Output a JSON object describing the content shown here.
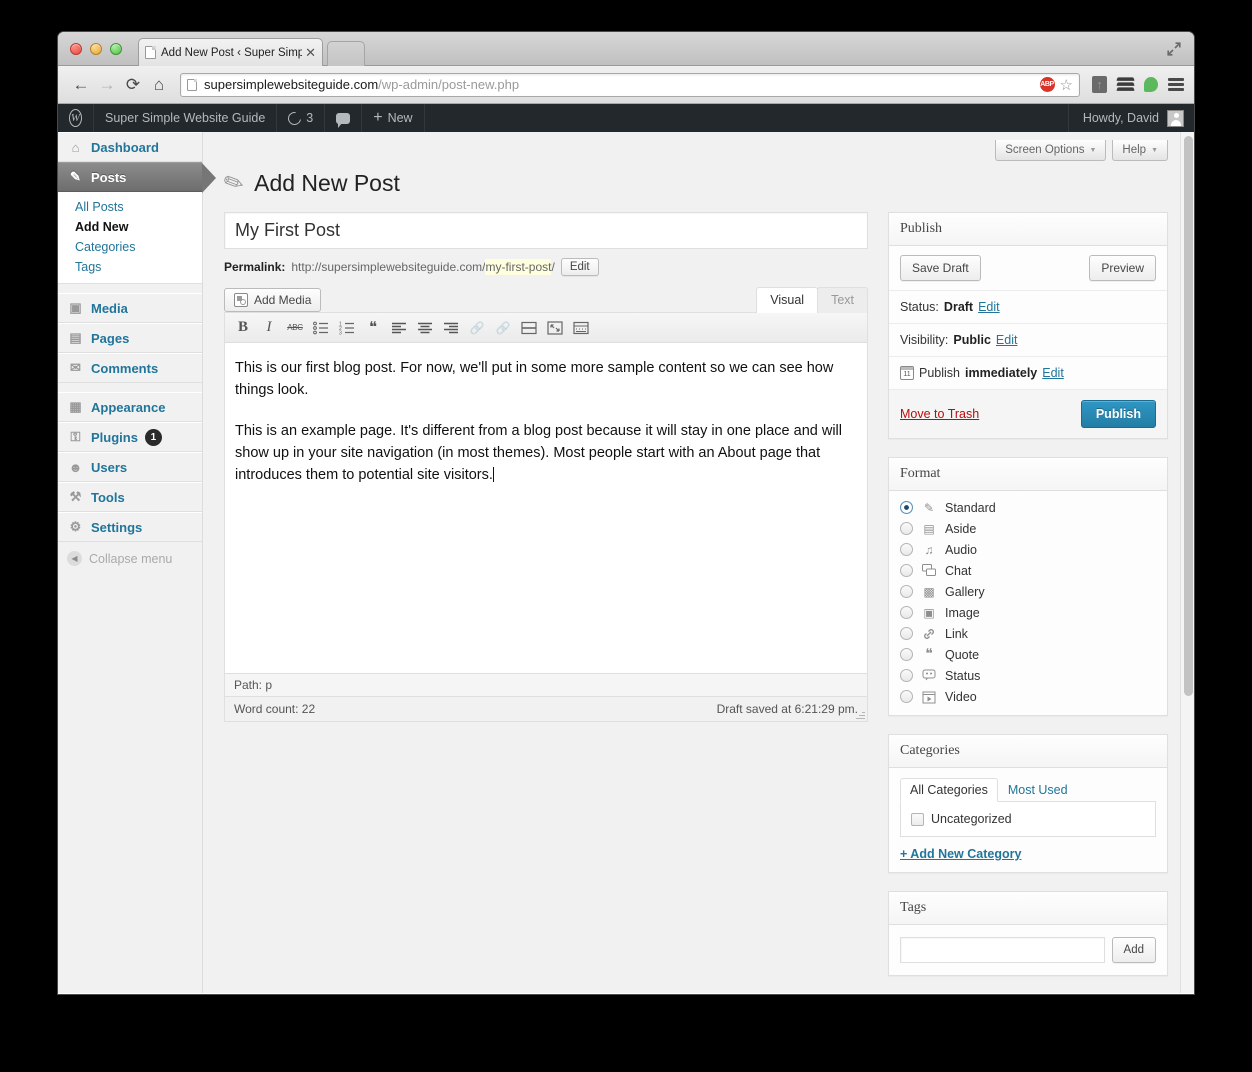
{
  "browser": {
    "tab_title": "Add New Post ‹ Super Simp",
    "tab_close": "✕",
    "url_domain": "supersimplewebsiteguide.com",
    "url_path": "/wp-admin/post-new.php",
    "back_icon": "←",
    "forward_icon": "→",
    "reload_icon": "⟳",
    "home_icon": "⌂",
    "abp_label": "ABP",
    "star_icon": "☆",
    "expand_icon": "⤢",
    "extensions": [
      "evernote-icon",
      "layers-icon",
      "bubble-icon",
      "menu-icon"
    ]
  },
  "adminbar": {
    "logo": "W",
    "site_name": "Super Simple Website Guide",
    "updates_count": "3",
    "comments_icon": "comment-icon",
    "new_label": "New",
    "plus": "+",
    "howdy": "Howdy, David"
  },
  "sidebar": {
    "items": [
      {
        "label": "Dashboard",
        "icon": "⌂",
        "current": false
      },
      {
        "label": "Posts",
        "icon": "✎",
        "current": true
      },
      {
        "label": "Media",
        "icon": "▣",
        "current": false
      },
      {
        "label": "Pages",
        "icon": "▤",
        "current": false
      },
      {
        "label": "Comments",
        "icon": "✉",
        "current": false
      },
      {
        "label": "Appearance",
        "icon": "▦",
        "current": false
      },
      {
        "label": "Plugins",
        "icon": "⚿",
        "current": false,
        "badge": "1"
      },
      {
        "label": "Users",
        "icon": "☻",
        "current": false
      },
      {
        "label": "Tools",
        "icon": "⚒",
        "current": false
      },
      {
        "label": "Settings",
        "icon": "⚙",
        "current": false
      }
    ],
    "submenu": [
      {
        "label": "All Posts",
        "current": false
      },
      {
        "label": "Add New",
        "current": true
      },
      {
        "label": "Categories",
        "current": false
      },
      {
        "label": "Tags",
        "current": false
      }
    ],
    "collapse_label": "Collapse menu",
    "collapse_icon": "◀"
  },
  "screen_meta": {
    "screen_options": "Screen Options",
    "help": "Help",
    "caret": "▼"
  },
  "page": {
    "title": "Add New Post",
    "pin_icon": "pin-icon"
  },
  "editor": {
    "post_title": "My First Post",
    "post_title_placeholder": "Enter title here",
    "permalink_label": "Permalink:",
    "permalink_base": "http://supersimplewebsiteguide.com/",
    "permalink_slug": "my-first-post",
    "permalink_trailing": "/",
    "permalink_edit": "Edit",
    "add_media": "Add Media",
    "tab_visual": "Visual",
    "tab_text": "Text",
    "toolbar": [
      {
        "name": "bold",
        "glyph": "B",
        "disabled": false
      },
      {
        "name": "italic",
        "glyph": "I",
        "disabled": false
      },
      {
        "name": "strikethrough",
        "glyph": "ABC",
        "disabled": false
      },
      {
        "name": "unordered-list",
        "glyph": "☰",
        "disabled": false
      },
      {
        "name": "ordered-list",
        "glyph": "☰",
        "disabled": false
      },
      {
        "name": "blockquote",
        "glyph": "❝",
        "disabled": false
      },
      {
        "name": "align-left",
        "glyph": "≡",
        "disabled": false
      },
      {
        "name": "align-center",
        "glyph": "≡",
        "disabled": false
      },
      {
        "name": "align-right",
        "glyph": "≡",
        "disabled": false
      },
      {
        "name": "insert-link",
        "glyph": "🔗",
        "disabled": true
      },
      {
        "name": "unlink",
        "glyph": "🔗",
        "disabled": true
      },
      {
        "name": "insert-more-tag",
        "glyph": "▤",
        "disabled": false
      },
      {
        "name": "fullscreen",
        "glyph": "⤢",
        "disabled": false
      },
      {
        "name": "kitchen-sink",
        "glyph": "▥",
        "disabled": false
      }
    ],
    "paragraphs": [
      "This is our first blog post. For now, we'll put in some more sample content so we can see how things look.",
      "This is an example page. It's different from a blog post because it will stay in one place and will show up in your site navigation (in most themes). Most people start with an About page that introduces them to potential site visitors."
    ],
    "path_label": "Path: p",
    "word_count": "Word count: 22",
    "draft_saved": "Draft saved at 6:21:29 pm."
  },
  "publish": {
    "heading": "Publish",
    "save_draft": "Save Draft",
    "preview": "Preview",
    "status_label": "Status:",
    "status_value": "Draft",
    "status_edit": "Edit",
    "visibility_label": "Visibility:",
    "visibility_value": "Public",
    "visibility_edit": "Edit",
    "publish_label": "Publish",
    "publish_value": "immediately",
    "publish_edit": "Edit",
    "trash": "Move to Trash",
    "publish_button": "Publish"
  },
  "format": {
    "heading": "Format",
    "options": [
      {
        "label": "Standard",
        "icon": "✎",
        "selected": true
      },
      {
        "label": "Aside",
        "icon": "▤",
        "selected": false
      },
      {
        "label": "Audio",
        "icon": "♫",
        "selected": false
      },
      {
        "label": "Chat",
        "icon": "💬",
        "selected": false
      },
      {
        "label": "Gallery",
        "icon": "▩",
        "selected": false
      },
      {
        "label": "Image",
        "icon": "▣",
        "selected": false
      },
      {
        "label": "Link",
        "icon": "🔗",
        "selected": false
      },
      {
        "label": "Quote",
        "icon": "❝",
        "selected": false
      },
      {
        "label": "Status",
        "icon": "☺",
        "selected": false
      },
      {
        "label": "Video",
        "icon": "▶",
        "selected": false
      }
    ]
  },
  "categories": {
    "heading": "Categories",
    "tab_all": "All Categories",
    "tab_most_used": "Most Used",
    "items": [
      {
        "label": "Uncategorized",
        "checked": false
      }
    ],
    "add_new": "+ Add New Category"
  },
  "tags": {
    "heading": "Tags",
    "input_value": "",
    "input_placeholder": "",
    "add_button": "Add"
  },
  "colors": {
    "accent": "#21759b",
    "admin_bar": "#23282d",
    "publish_button": "#2f96c4",
    "trash_link": "#bc0b0b",
    "slug_highlight": "#ffffe0"
  }
}
